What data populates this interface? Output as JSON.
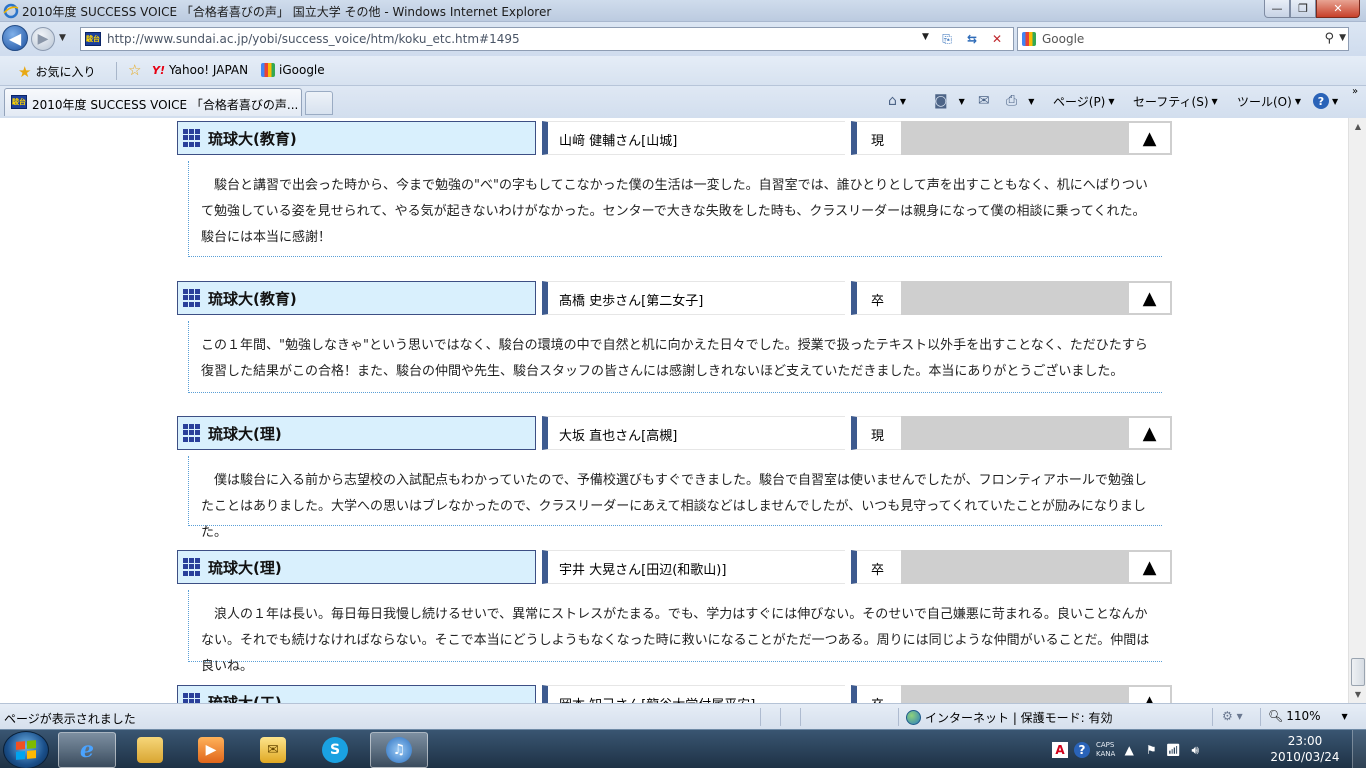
{
  "window": {
    "title": "2010年度 SUCCESS VOICE 「合格者喜びの声」 国立大学 その他 - Windows Internet Explorer",
    "minimize": "—",
    "maximize": "❐",
    "close": "✕"
  },
  "address_bar": {
    "url": "http://www.sundai.ac.jp/yobi/success_voice/htm/koku_etc.htm#1495",
    "favicon_text": "駿台"
  },
  "search": {
    "placeholder": "Google"
  },
  "favorites_bar": {
    "favorites_label": "お気に入り",
    "items": [
      {
        "label": "Yahoo! JAPAN",
        "icon": "yahoo-icon",
        "icon_text": "Y!"
      },
      {
        "label": "iGoogle",
        "icon": "igoogle-icon"
      }
    ]
  },
  "tabs": [
    {
      "label": "2010年度 SUCCESS VOICE 「合格者喜びの声...",
      "active": true
    }
  ],
  "command_bar": {
    "page": "ページ(P)",
    "safety": "セーフティ(S)",
    "tools": "ツール(O)",
    "help": "?"
  },
  "entries": [
    {
      "university": "琉球大(教育)",
      "name": "山﨑 健輔さん[山城]",
      "status": "現",
      "text": "　駿台と講習で出会った時から、今まで勉強の\"べ\"の字もしてこなかった僕の生活は一変した。自習室では、誰ひとりとして声を出すこともなく、机にへばりついて勉強している姿を見せられて、やる気が起きないわけがなかった。センターで大きな失敗をした時も、クラスリーダーは親身になって僕の相談に乗ってくれた。駿台には本当に感謝！"
    },
    {
      "university": "琉球大(教育)",
      "name": "髙橋 史歩さん[第二女子]",
      "status": "卒",
      "text": "この１年間、\"勉強しなきゃ\"という思いではなく、駿台の環境の中で自然と机に向かえた日々でした。授業で扱ったテキスト以外手を出すことなく、ただひたすら復習した結果がこの合格！また、駿台の仲間や先生、駿台スタッフの皆さんには感謝しきれないほど支えていただきました。本当にありがとうございました。"
    },
    {
      "university": "琉球大(理)",
      "name": "大坂 直也さん[高槻]",
      "status": "現",
      "text": "　僕は駿台に入る前から志望校の入試配点もわかっていたので、予備校選びもすぐできました。駿台で自習室は使いませんでしたが、フロンティアホールで勉強したことはありました。大学への思いはブレなかったので、クラスリーダーにあえて相談などはしませんでしたが、いつも見守ってくれていたことが励みになりました。"
    },
    {
      "university": "琉球大(理)",
      "name": "宇井 大晃さん[田辺(和歌山)]",
      "status": "卒",
      "text": "　浪人の１年は長い。毎日毎日我慢し続けるせいで、異常にストレスがたまる。でも、学力はすぐには伸びない。そのせいで自己嫌悪に苛まれる。良いことなんかない。それでも続けなければならない。そこで本当にどうしようもなくなった時に救いになることがただ一つある。周りには同じような仲間がいることだ。仲間は良いね。"
    },
    {
      "university": "琉球大(工)",
      "name": "岡本 知己さん[龍谷大学付属平安]",
      "status": "卒",
      "text": ""
    }
  ],
  "to_top_glyph": "▲",
  "status_bar": {
    "text": "ページが表示されました",
    "zone": "インターネット | 保護モード: 有効",
    "zoom": "110%"
  },
  "taskbar": {
    "time": "23:00",
    "date": "2010/03/24",
    "caps": "CAPS",
    "kana": "KANA"
  }
}
